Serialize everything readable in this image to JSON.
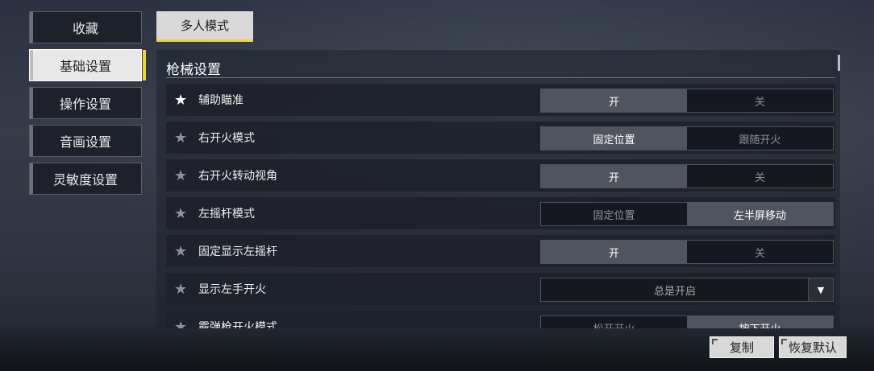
{
  "sidebar": {
    "items": [
      {
        "label": "收藏",
        "active": false
      },
      {
        "label": "基础设置",
        "active": true
      },
      {
        "label": "操作设置",
        "active": false
      },
      {
        "label": "音画设置",
        "active": false
      },
      {
        "label": "灵敏度设置",
        "active": false
      }
    ]
  },
  "mode_tab": "多人模式",
  "section_title": "枪械设置",
  "settings": [
    {
      "label": "辅助瞄准",
      "starred": true,
      "options": [
        "开",
        "关"
      ],
      "selected": 0
    },
    {
      "label": "右开火模式",
      "starred": false,
      "options": [
        "固定位置",
        "跟随开火"
      ],
      "selected": 0
    },
    {
      "label": "右开火转动视角",
      "starred": false,
      "options": [
        "开",
        "关"
      ],
      "selected": 0
    },
    {
      "label": "左摇杆模式",
      "starred": false,
      "options": [
        "固定位置",
        "左半屏移动"
      ],
      "selected": 1
    },
    {
      "label": "固定显示左摇杆",
      "starred": false,
      "options": [
        "开",
        "关"
      ],
      "selected": 0
    },
    {
      "label": "显示左手开火",
      "starred": false,
      "dropdown": "总是开启"
    },
    {
      "label": "霰弹枪开火模式",
      "starred": false,
      "options": [
        "松开开火",
        "按下开火"
      ],
      "selected": 1
    }
  ],
  "buttons": {
    "copy": "复制",
    "restore_default": "恢复默认"
  },
  "colors": {
    "accent": "#f2d23c",
    "selected_option": "#50545c"
  }
}
